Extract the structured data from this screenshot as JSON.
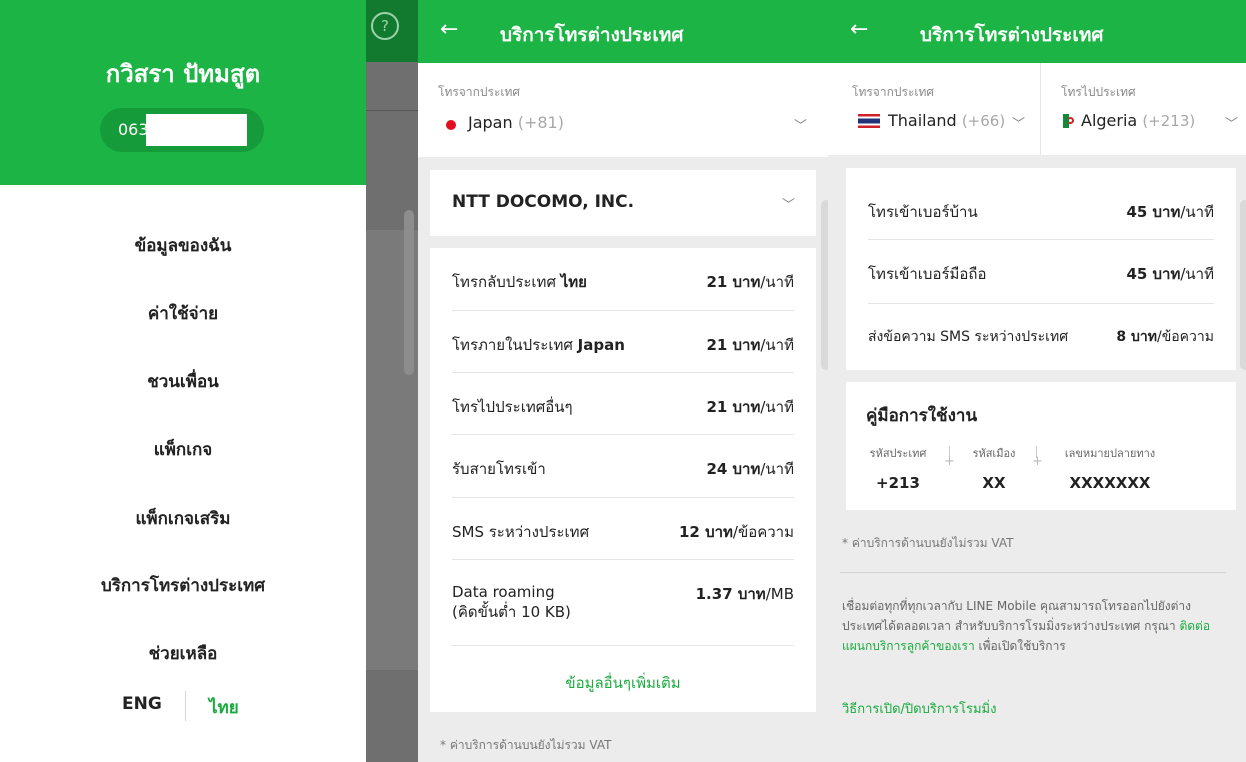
{
  "drawer": {
    "user_name": "กวิสรา ปัทมสูต",
    "phone_prefix": "063",
    "menu": [
      "ข้อมูลของฉัน",
      "ค่าใช้จ่าย",
      "ชวนเพื่อน",
      "แพ็กเกจ",
      "แพ็กเกจเสริม",
      "บริการโทรต่างประเทศ",
      "ช่วยเหลือ"
    ],
    "lang_en": "ENG",
    "lang_th": "ไทย"
  },
  "overlay": {
    "help_icon": "?"
  },
  "screen_a": {
    "back_icon": "←",
    "title": "บริการโทรต่างประเทศ",
    "from_label": "โทรจากประเทศ",
    "from_country": "Japan",
    "from_code": "(+81)",
    "carrier": "NTT DOCOMO, INC.",
    "rates": [
      {
        "label_pre": "โทรกลับประเทศ ",
        "label_bold": "ไทย",
        "amount": "21 บาท",
        "unit": "/นาที"
      },
      {
        "label_pre": "โทรภายในประเทศ ",
        "label_bold": "Japan",
        "amount": "21 บาท",
        "unit": "/นาที"
      },
      {
        "label_pre": "โทรไปประเทศอื่นๆ",
        "label_bold": "",
        "amount": "21 บาท",
        "unit": "/นาที"
      },
      {
        "label_pre": "รับสายโทรเข้า",
        "label_bold": "",
        "amount": "24 บาท",
        "unit": "/นาที"
      },
      {
        "label_pre": "SMS ระหว่างประเทศ",
        "label_bold": "",
        "amount": "12 บาท",
        "unit": "/ข้อความ"
      }
    ],
    "data_roaming_line1": "Data roaming",
    "data_roaming_line2": "(คิดขั้นต่ำ 10 KB)",
    "data_roaming_amount": "1.37 บาท",
    "data_roaming_unit": "/MB",
    "more_info": "ข้อมูลอื่นๆเพิ่มเติม",
    "vat_note": "* ค่าบริการด้านบนยังไม่รวม VAT"
  },
  "screen_b": {
    "back_icon": "←",
    "title": "บริการโทรต่างประเทศ",
    "from_label": "โทรจากประเทศ",
    "from_country": "Thailand",
    "from_code": "(+66)",
    "to_label": "โทรไปประเทศ",
    "to_country": "Algeria",
    "to_code": "(+213)",
    "rates": [
      {
        "label": "โทรเข้าเบอร์บ้าน",
        "amount": "45 บาท",
        "unit": "/นาที"
      },
      {
        "label": "โทรเข้าเบอร์มือถือ",
        "amount": "45 บาท",
        "unit": "/นาที"
      },
      {
        "label": "ส่งข้อความ SMS ระหว่างประเทศ",
        "amount": "8 บาท",
        "unit": "/ข้อความ"
      }
    ],
    "guide_title": "คู่มือการใช้งาน",
    "guide": [
      {
        "label": "รหัสประเทศ",
        "value": "+213"
      },
      {
        "label": "รหัสเมือง",
        "value": "XX"
      },
      {
        "label": "เลขหมายปลายทาง",
        "value": "XXXXXXX"
      }
    ],
    "vat_note": "* ค่าบริการด้านบนยังไม่รวม VAT",
    "para_1": "เชื่อมต่อทุกที่ทุกเวลากับ LINE Mobile คุณสามารถโทรออกไปยังต่างประเทศได้ตลอดเวลา สำหรับบริการโรมมิ่งระหว่างประเทศ กรุณา ",
    "para_link": "ติดต่อแผนกบริการลูกค้าของเรา",
    "para_2": " เพื่อเปิดใช้บริการ",
    "toggle_link": "วิธีการเปิด/ปิดบริการโรมมิ่ง"
  },
  "colors": {
    "brand_green": "#1db446",
    "accent_green": "#1aab3f",
    "red_dot": "#e0101e"
  }
}
